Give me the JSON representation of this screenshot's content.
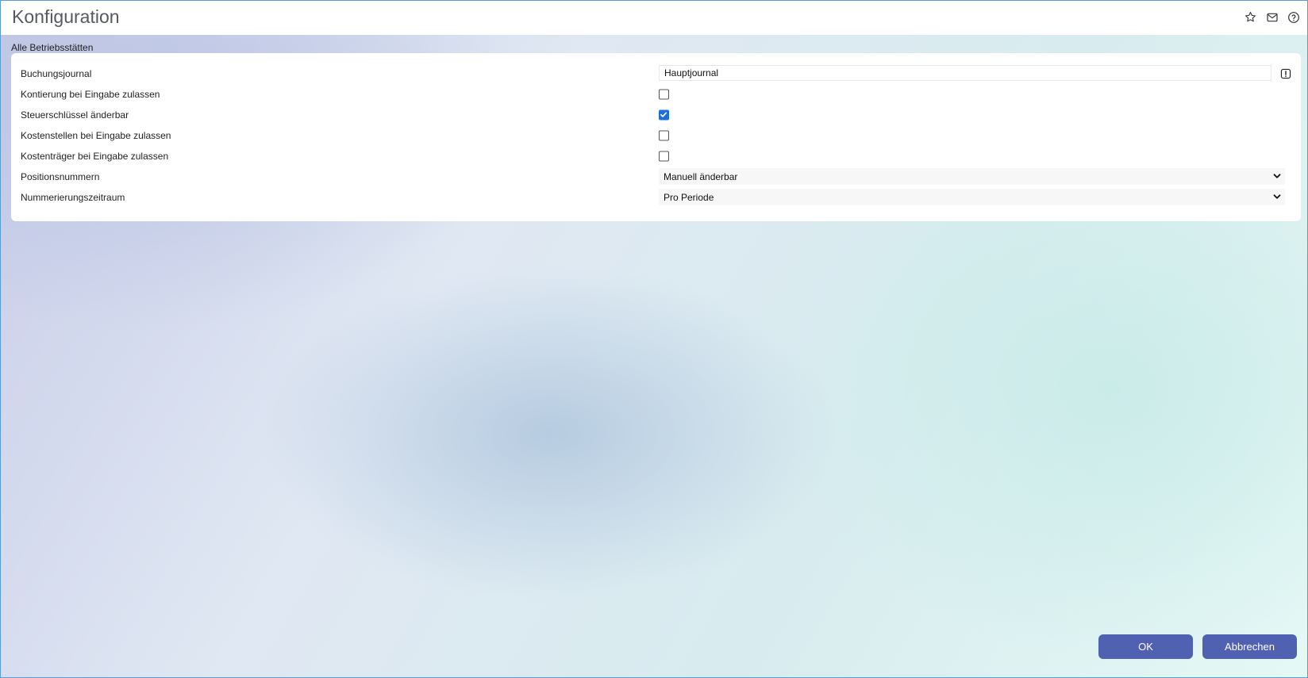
{
  "header": {
    "title": "Konfiguration",
    "icons": [
      "star-icon",
      "mail-icon",
      "help-icon"
    ]
  },
  "section": {
    "label": "Alle Betriebsstätten"
  },
  "form": {
    "buchungsjournal": {
      "label": "Buchungsjournal",
      "value": "Hauptjournal"
    },
    "kontierung": {
      "label": "Kontierung bei Eingabe zulassen",
      "checked": false
    },
    "steuerschluessel": {
      "label": "Steuerschlüssel änderbar",
      "checked": true
    },
    "kostenstellen": {
      "label": "Kostenstellen bei Eingabe zulassen",
      "checked": false
    },
    "kostentraeger": {
      "label": "Kostenträger bei Eingabe zulassen",
      "checked": false
    },
    "positionsnummern": {
      "label": "Positionsnummern",
      "value": "Manuell änderbar"
    },
    "nummerierungszeitraum": {
      "label": "Nummerierungszeitraum",
      "value": "Pro Periode"
    }
  },
  "footer": {
    "ok_label": "OK",
    "cancel_label": "Abbrechen"
  },
  "colors": {
    "button_bg": "#4f61b0",
    "checkbox_checked": "#1f6fd8",
    "frame_border": "#5b9bd5"
  }
}
